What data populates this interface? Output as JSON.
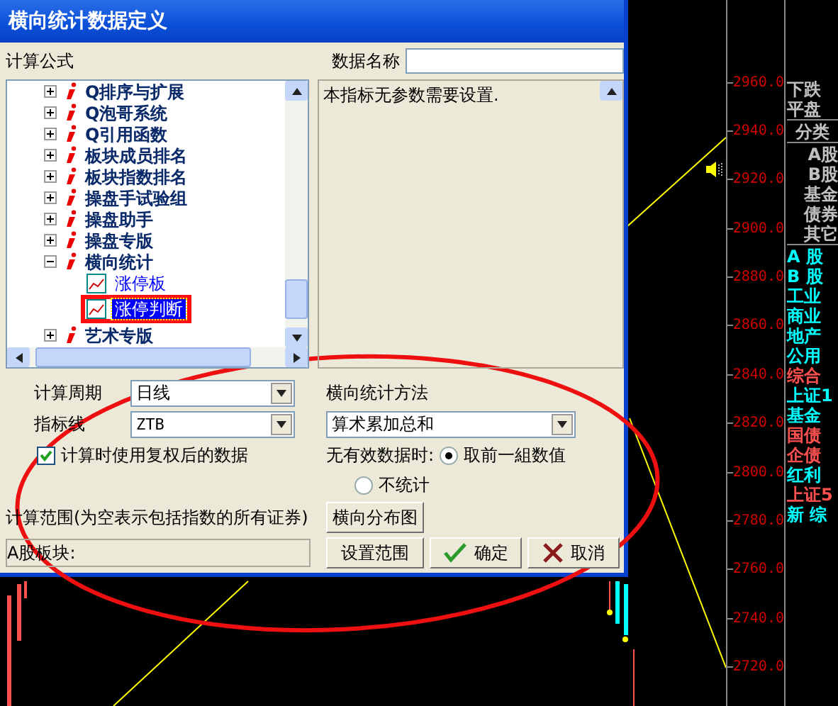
{
  "dialog": {
    "title": "横向统计数据定义",
    "formula_label": "计算公式",
    "data_name": {
      "label": "数据名称"
    },
    "tree": [
      {
        "label": "Q排序与扩展",
        "expanded": false
      },
      {
        "label": "Q泡哥系统",
        "expanded": false
      },
      {
        "label": "Q引用函数",
        "expanded": false
      },
      {
        "label": "板块成员排名",
        "expanded": false
      },
      {
        "label": "板块指数排名",
        "expanded": false
      },
      {
        "label": "操盘手试验组",
        "expanded": false
      },
      {
        "label": "操盘助手",
        "expanded": false
      },
      {
        "label": "操盘专版",
        "expanded": false
      },
      {
        "label": "横向统计",
        "expanded": true,
        "children": [
          {
            "label": "涨停板",
            "selected": false
          },
          {
            "label": "涨停判断",
            "selected": true
          }
        ]
      },
      {
        "label": "艺术专版",
        "expanded": false
      }
    ],
    "description": "本指标无参数需要设置.",
    "period": {
      "label": "计算周期",
      "value": "日线"
    },
    "indicator_line": {
      "label": "指标线",
      "value": "ZTB"
    },
    "adjusted_checkbox": {
      "label": "计算时使用复权后的数据",
      "checked": true
    },
    "method": {
      "label": "横向统计方法",
      "value": "算术累加总和"
    },
    "no_data": {
      "label": "无有效数据时:",
      "options": [
        {
          "label": "取前一組数值",
          "selected": true
        },
        {
          "label": "不统计",
          "selected": false
        }
      ]
    },
    "range_label": "计算范围(为空表示包括指数的所有证券)",
    "range_value": "A股板块:",
    "buttons": [
      {
        "label": "横向分布图",
        "kind": "plain"
      },
      {
        "label": "设置范围",
        "kind": "plain"
      },
      {
        "label": "确定",
        "kind": "ok"
      },
      {
        "label": "取消",
        "kind": "cancel"
      }
    ]
  },
  "price_axis": [
    "2960.0",
    "2940.0",
    "2920.0",
    "2900.0",
    "2880.0",
    "2860.0",
    "2840.0",
    "2820.0",
    "2800.0",
    "2780.0",
    "2760.0",
    "2740.0",
    "2720.0"
  ],
  "market_panel": {
    "top_items": [
      "下跌",
      "平盘"
    ],
    "category_header": "分类",
    "categories": [
      "A股",
      "B股",
      "基金",
      "债券",
      "其它"
    ],
    "indices": [
      {
        "label": "A 股",
        "color": "#00ffff"
      },
      {
        "label": "B 股",
        "color": "#00ffff"
      },
      {
        "label": "工业",
        "color": "#00ffff"
      },
      {
        "label": "商业",
        "color": "#00ffff"
      },
      {
        "label": "地产",
        "color": "#00ffff"
      },
      {
        "label": "公用",
        "color": "#00ffff"
      },
      {
        "label": "综合",
        "color": "#ff5050"
      },
      {
        "label": "上证1",
        "color": "#00ffff"
      },
      {
        "label": "基金",
        "color": "#00ffff"
      },
      {
        "label": "国债",
        "color": "#ff5050"
      },
      {
        "label": "企债",
        "color": "#ff5050"
      },
      {
        "label": "红利",
        "color": "#00ffff"
      },
      {
        "label": "上证5",
        "color": "#ff5050"
      },
      {
        "label": "新 综",
        "color": "#00ffff"
      }
    ]
  }
}
